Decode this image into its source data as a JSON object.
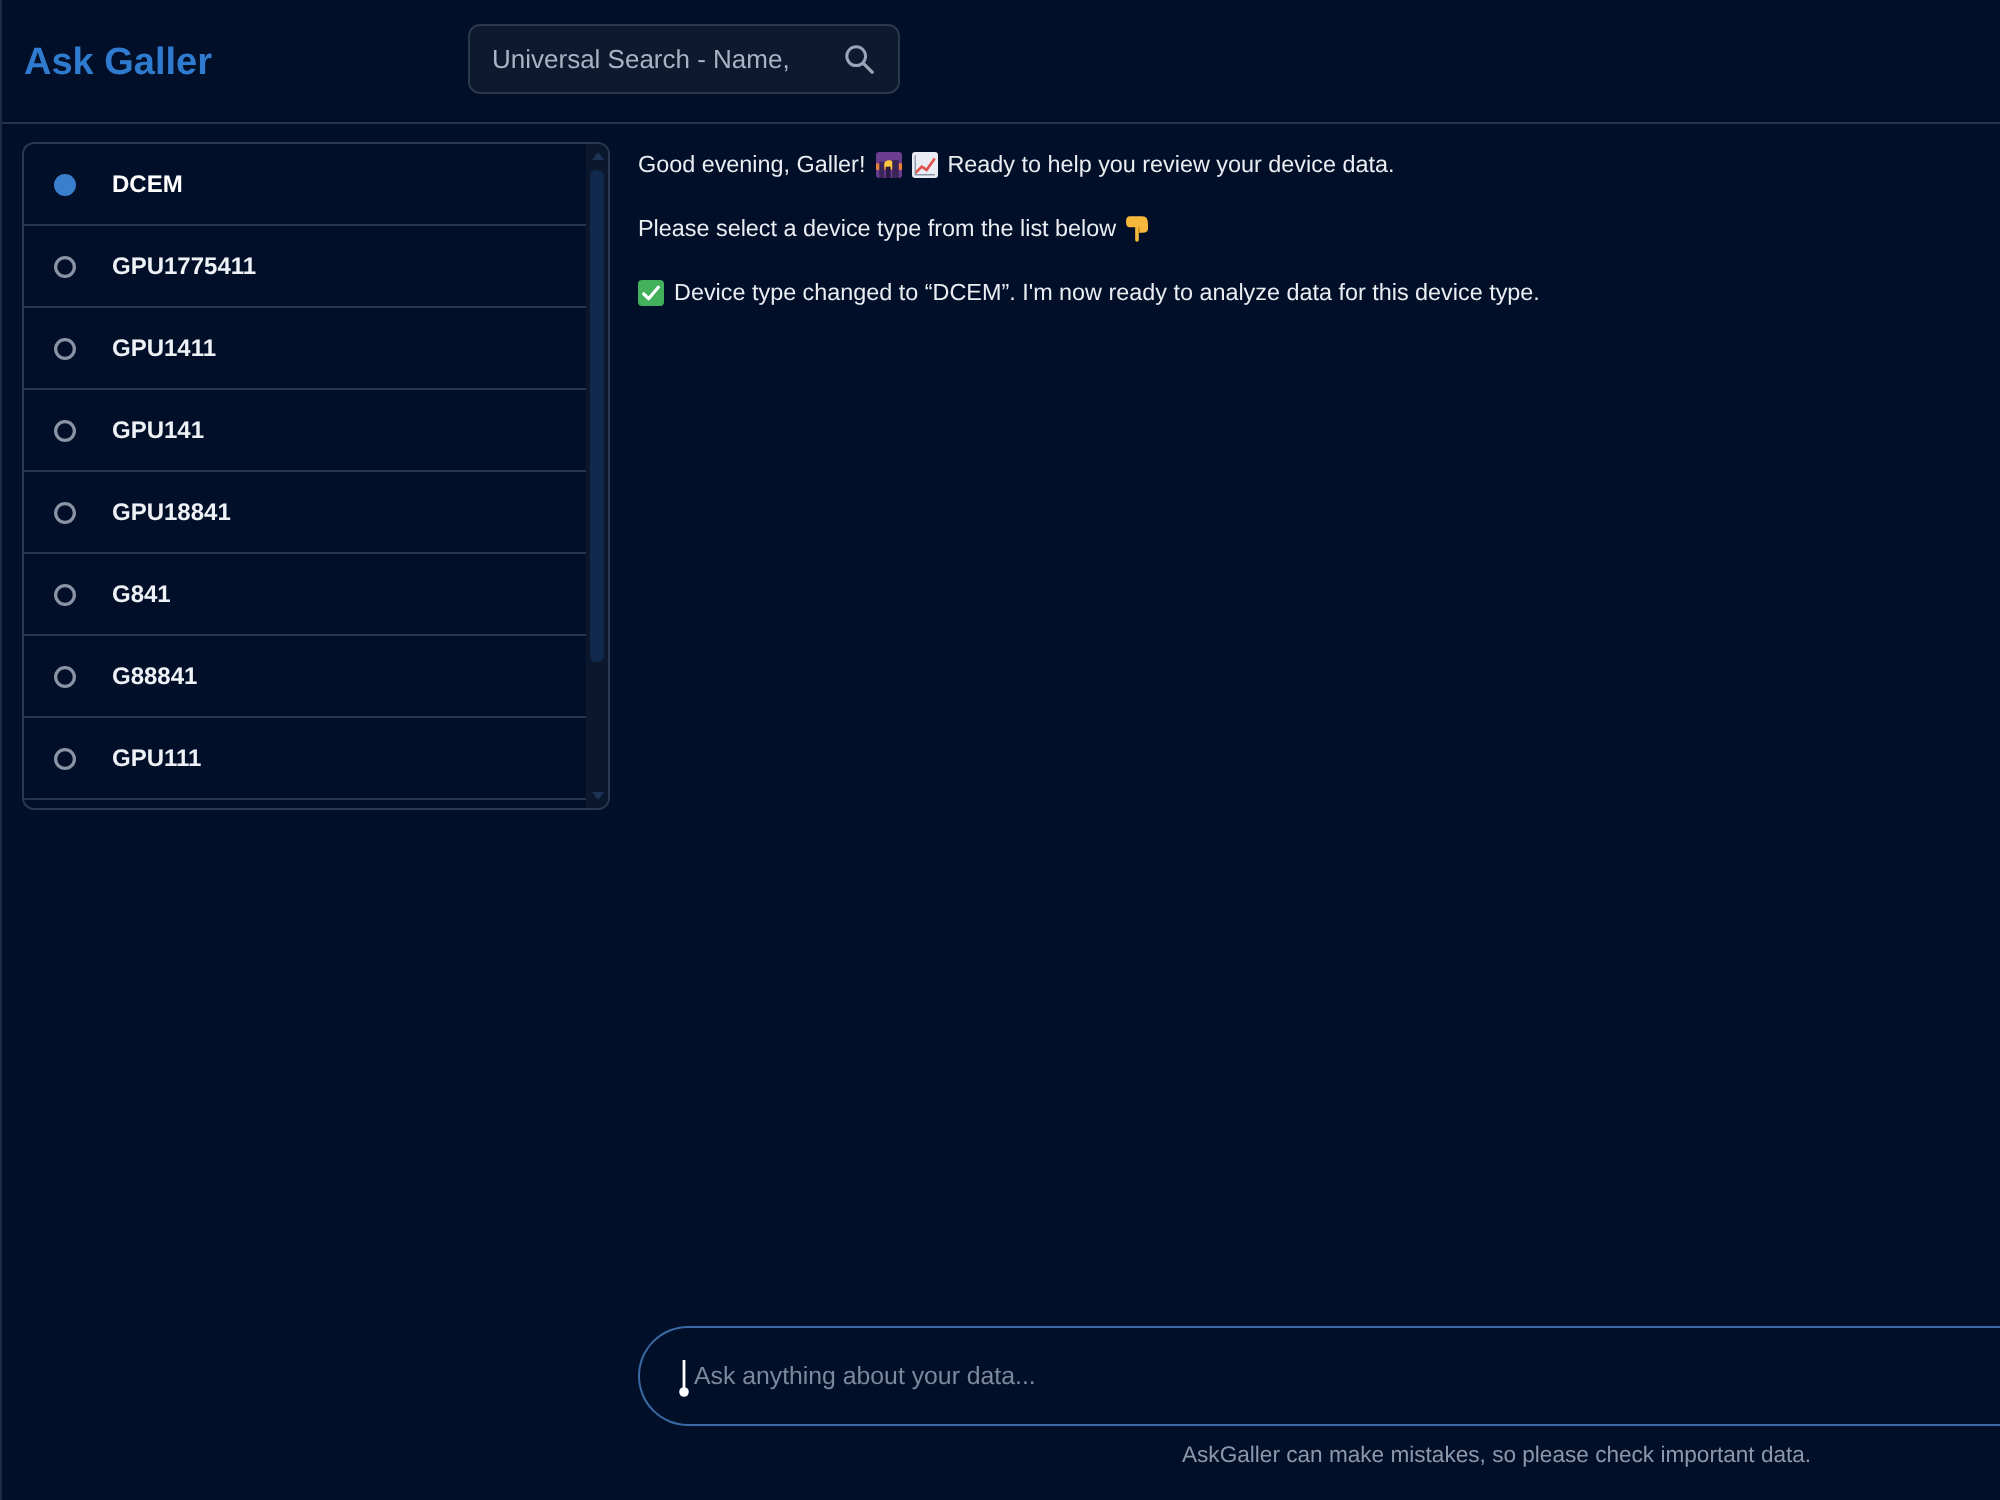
{
  "app": {
    "title": "Ask Galler"
  },
  "search": {
    "placeholder": "Universal Search - Name,"
  },
  "device_list": {
    "items": [
      {
        "label": "DCEM",
        "selected": true
      },
      {
        "label": "GPU1775411",
        "selected": false
      },
      {
        "label": "GPU1411",
        "selected": false
      },
      {
        "label": "GPU141",
        "selected": false
      },
      {
        "label": "GPU18841",
        "selected": false
      },
      {
        "label": "G841",
        "selected": false
      },
      {
        "label": "G88841",
        "selected": false
      },
      {
        "label": "GPU111",
        "selected": false
      }
    ]
  },
  "messages": [
    {
      "kind": "greeting",
      "lead": "Good evening, Galler!",
      "text": "Ready to help you review your device data."
    },
    {
      "kind": "prompt",
      "text": "Please select a device type from the list below"
    },
    {
      "kind": "confirmation",
      "text": "Device type changed to “DCEM”. I'm now ready to analyze data for this device type."
    }
  ],
  "chat_input": {
    "placeholder": "Ask anything about your data..."
  },
  "disclaimer": "AskGaller can make mistakes, so please check important data."
}
